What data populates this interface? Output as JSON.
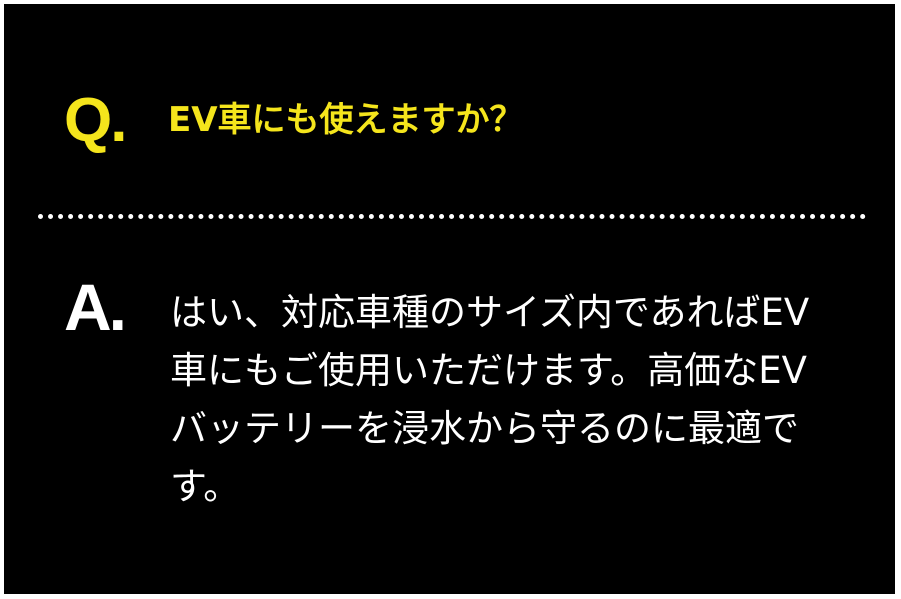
{
  "question": {
    "marker": "Q.",
    "text": "EV車にも使えますか？"
  },
  "answer": {
    "marker": "A.",
    "lines": [
      "はい、対応車種のサイズ内であればEV",
      "車にもご使用いただけます。高価なEV",
      "バッテリーを浸水から守るのに最適で",
      "す。"
    ]
  },
  "colors": {
    "background": "#000000",
    "accent": "#f5e51c",
    "text": "#ffffff"
  }
}
